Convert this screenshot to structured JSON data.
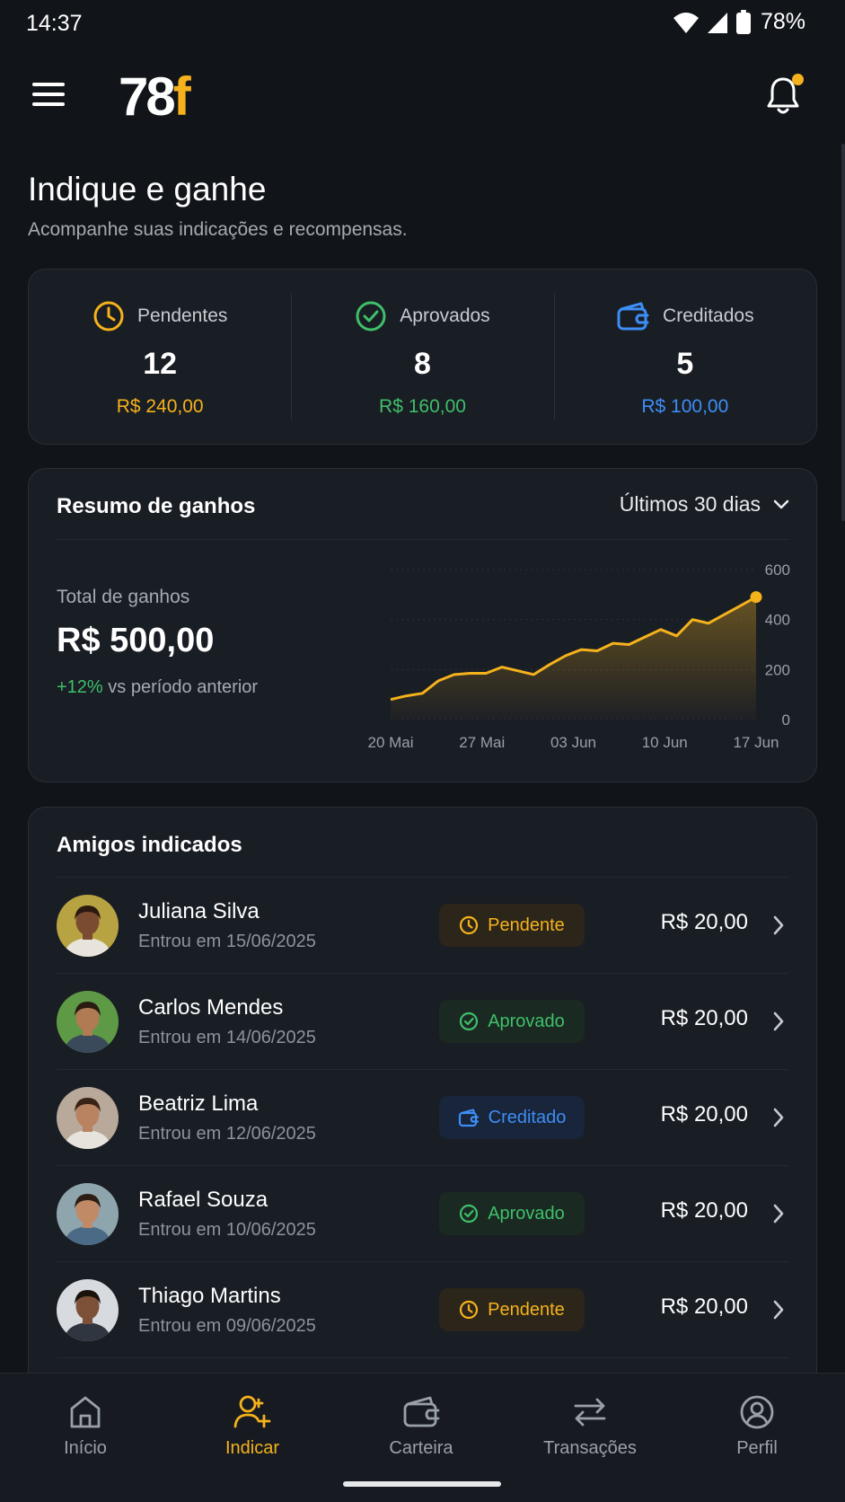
{
  "status_bar": {
    "time": "14:37",
    "battery": "78%"
  },
  "header": {
    "logo_main": "78",
    "logo_accent": "f"
  },
  "page": {
    "title": "Indique e ganhe",
    "subtitle": "Acompanhe suas indicações e recompensas."
  },
  "stats": [
    {
      "label": "Pendentes",
      "count": "12",
      "amount": "R$ 240,00",
      "color": "#f5b21c",
      "icon": "clock-icon"
    },
    {
      "label": "Aprovados",
      "count": "8",
      "amount": "R$ 160,00",
      "color": "#3fbf6a",
      "icon": "check-circle-icon"
    },
    {
      "label": "Creditados",
      "count": "5",
      "amount": "R$ 100,00",
      "color": "#3d8ef5",
      "icon": "wallet-icon"
    }
  ],
  "earnings": {
    "title": "Resumo de ganhos",
    "period": "Últimos 30 dias",
    "total_label": "Total de ganhos",
    "total_value": "R$ 500,00",
    "growth_value": "+12%",
    "growth_text": "vs período anterior"
  },
  "chart_data": {
    "type": "area",
    "x_labels": [
      "20 Mai",
      "27 Mai",
      "03 Jun",
      "10 Jun",
      "17 Jun"
    ],
    "y_ticks": [
      0,
      200,
      400,
      600
    ],
    "ylim": [
      0,
      600
    ],
    "values": [
      80,
      95,
      105,
      155,
      180,
      185,
      185,
      210,
      195,
      180,
      220,
      255,
      280,
      275,
      305,
      300,
      330,
      360,
      335,
      400,
      385,
      420,
      455,
      490
    ],
    "color": "#f5b21c",
    "grid": true
  },
  "friends": {
    "title": "Amigos indicados",
    "items": [
      {
        "name": "Juliana Silva",
        "date": "Entrou em 15/06/2025",
        "status": "Pendente",
        "status_type": "pending",
        "amount": "R$ 20,00"
      },
      {
        "name": "Carlos Mendes",
        "date": "Entrou em 14/06/2025",
        "status": "Aprovado",
        "status_type": "approved",
        "amount": "R$ 20,00"
      },
      {
        "name": "Beatriz Lima",
        "date": "Entrou em 12/06/2025",
        "status": "Creditado",
        "status_type": "credited",
        "amount": "R$ 20,00"
      },
      {
        "name": "Rafael Souza",
        "date": "Entrou em 10/06/2025",
        "status": "Aprovado",
        "status_type": "approved",
        "amount": "R$ 20,00"
      },
      {
        "name": "Thiago Martins",
        "date": "Entrou em 09/06/2025",
        "status": "Pendente",
        "status_type": "pending",
        "amount": "R$ 20,00"
      }
    ]
  },
  "nav": [
    {
      "label": "Início",
      "icon": "home-icon",
      "active": false
    },
    {
      "label": "Indicar",
      "icon": "add-user-icon",
      "active": true
    },
    {
      "label": "Carteira",
      "icon": "wallet-icon",
      "active": false
    },
    {
      "label": "Transações",
      "icon": "transfer-icon",
      "active": false
    },
    {
      "label": "Perfil",
      "icon": "profile-icon",
      "active": false
    }
  ]
}
